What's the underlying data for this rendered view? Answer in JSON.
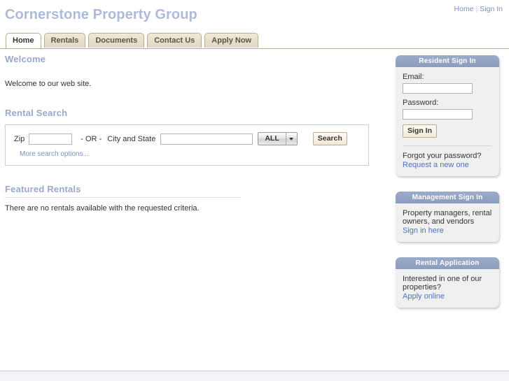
{
  "header": {
    "logo": "Cornerstone Property Group",
    "links": [
      {
        "label": "Home"
      },
      {
        "label": "Sign In"
      }
    ],
    "separator": "|"
  },
  "tabs": [
    {
      "label": "Home",
      "active": true
    },
    {
      "label": "Rentals",
      "active": false
    },
    {
      "label": "Documents",
      "active": false
    },
    {
      "label": "Contact Us",
      "active": false
    },
    {
      "label": "Apply Now",
      "active": false
    }
  ],
  "main": {
    "welcome": {
      "heading": "Welcome",
      "text": "Welcome to our web site."
    },
    "rental_search": {
      "heading": "Rental Search",
      "zip_label": "Zip",
      "zip_value": "",
      "or_label": "- OR -",
      "city_label": "City and State",
      "city_value": "",
      "type_selected": "ALL",
      "type_options": [
        "ALL"
      ],
      "search_button": "Search",
      "more_options_link": "More search options..."
    },
    "featured_rentals": {
      "heading": "Featured Rentals",
      "empty_message": "There are no rentals available with the requested criteria."
    }
  },
  "sidebar": {
    "resident_sign_in": {
      "title": "Resident Sign In",
      "email_label": "Email:",
      "email_value": "",
      "password_label": "Password:",
      "password_value": "",
      "sign_in_button": "Sign In",
      "forgot_text": "Forgot your password?",
      "forgot_link": "Request a new one"
    },
    "management_sign_in": {
      "title": "Management Sign In",
      "description": "Property managers, rental owners, and vendors",
      "link": "Sign in here"
    },
    "rental_application": {
      "title": "Rental Application",
      "description": "Interested in one of our properties?",
      "link": "Apply online"
    }
  },
  "footer": {
    "text": ""
  },
  "colors": {
    "logo": "#aebada",
    "heading": "#9aa8cc",
    "panel_header": "#8c9cbe",
    "link": "#4f72b8",
    "tab_border": "#b9ad8e",
    "tab_bg": "#e6dfca"
  }
}
